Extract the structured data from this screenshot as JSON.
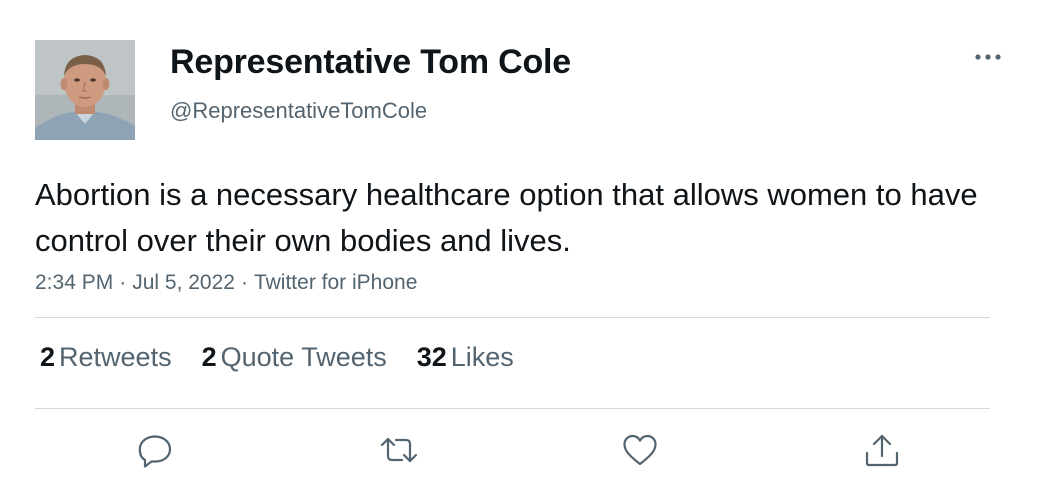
{
  "tweet": {
    "author": {
      "display_name": "Representative Tom Cole",
      "handle": "@RepresentativeTomCole"
    },
    "text": "Abortion is a necessary healthcare option that allows women to have control over their own bodies and lives.",
    "time": "2:34 PM",
    "date": "Jul 5, 2022",
    "source": "Twitter for iPhone",
    "separator": "·",
    "stats": {
      "retweets_count": "2",
      "retweets_label": "Retweets",
      "quote_tweets_count": "2",
      "quote_tweets_label": "Quote Tweets",
      "likes_count": "32",
      "likes_label": "Likes"
    }
  },
  "icons": {
    "more": "more-horizontal-icon",
    "reply": "reply-icon",
    "retweet": "retweet-icon",
    "like": "heart-icon",
    "share": "share-icon"
  },
  "colors": {
    "text_primary": "#0f1419",
    "text_secondary": "#536471",
    "divider": "#cfd9de"
  }
}
